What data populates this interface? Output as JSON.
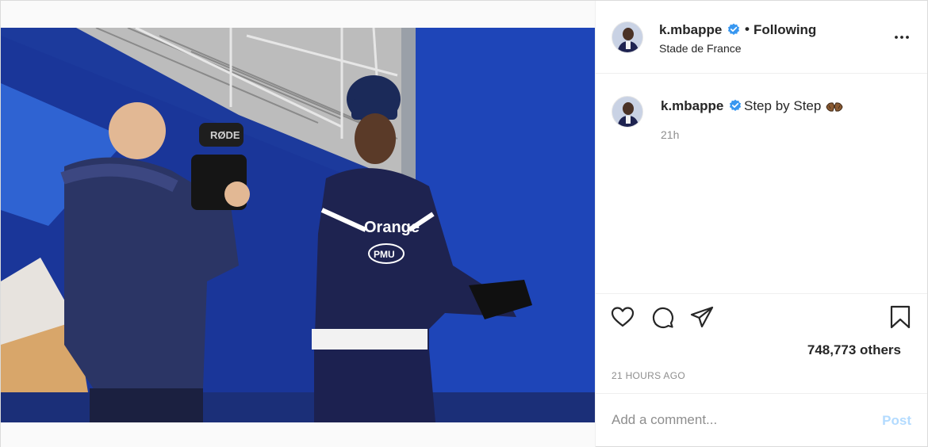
{
  "post": {
    "username": "k.mbappe",
    "verified": true,
    "follow_status": "Following",
    "separator": "•",
    "location": "Stade de France",
    "more_icon": "more-options-icon",
    "caption_user": "k.mbappe",
    "caption_text": "Step by Step",
    "caption_emoji": "clapping-hands-emoji",
    "comment_time": "21h",
    "likes": "748,773 others",
    "timestamp": "21 HOURS AGO",
    "photo_text": {
      "mic_brand": "RØDE",
      "jersey_sponsor": "Orange",
      "jersey_badge": "PMU"
    }
  },
  "actions": {
    "like_icon": "heart-icon",
    "comment_icon": "comment-bubble-icon",
    "share_icon": "paper-plane-icon",
    "save_icon": "bookmark-icon"
  },
  "comment_box": {
    "placeholder": "Add a comment...",
    "post_label": "Post"
  },
  "colors": {
    "verified_blue": "#3897f0",
    "post_button_disabled": "#b3dbff",
    "secondary_text": "#8e8e8e",
    "border": "#dbdbdb"
  }
}
